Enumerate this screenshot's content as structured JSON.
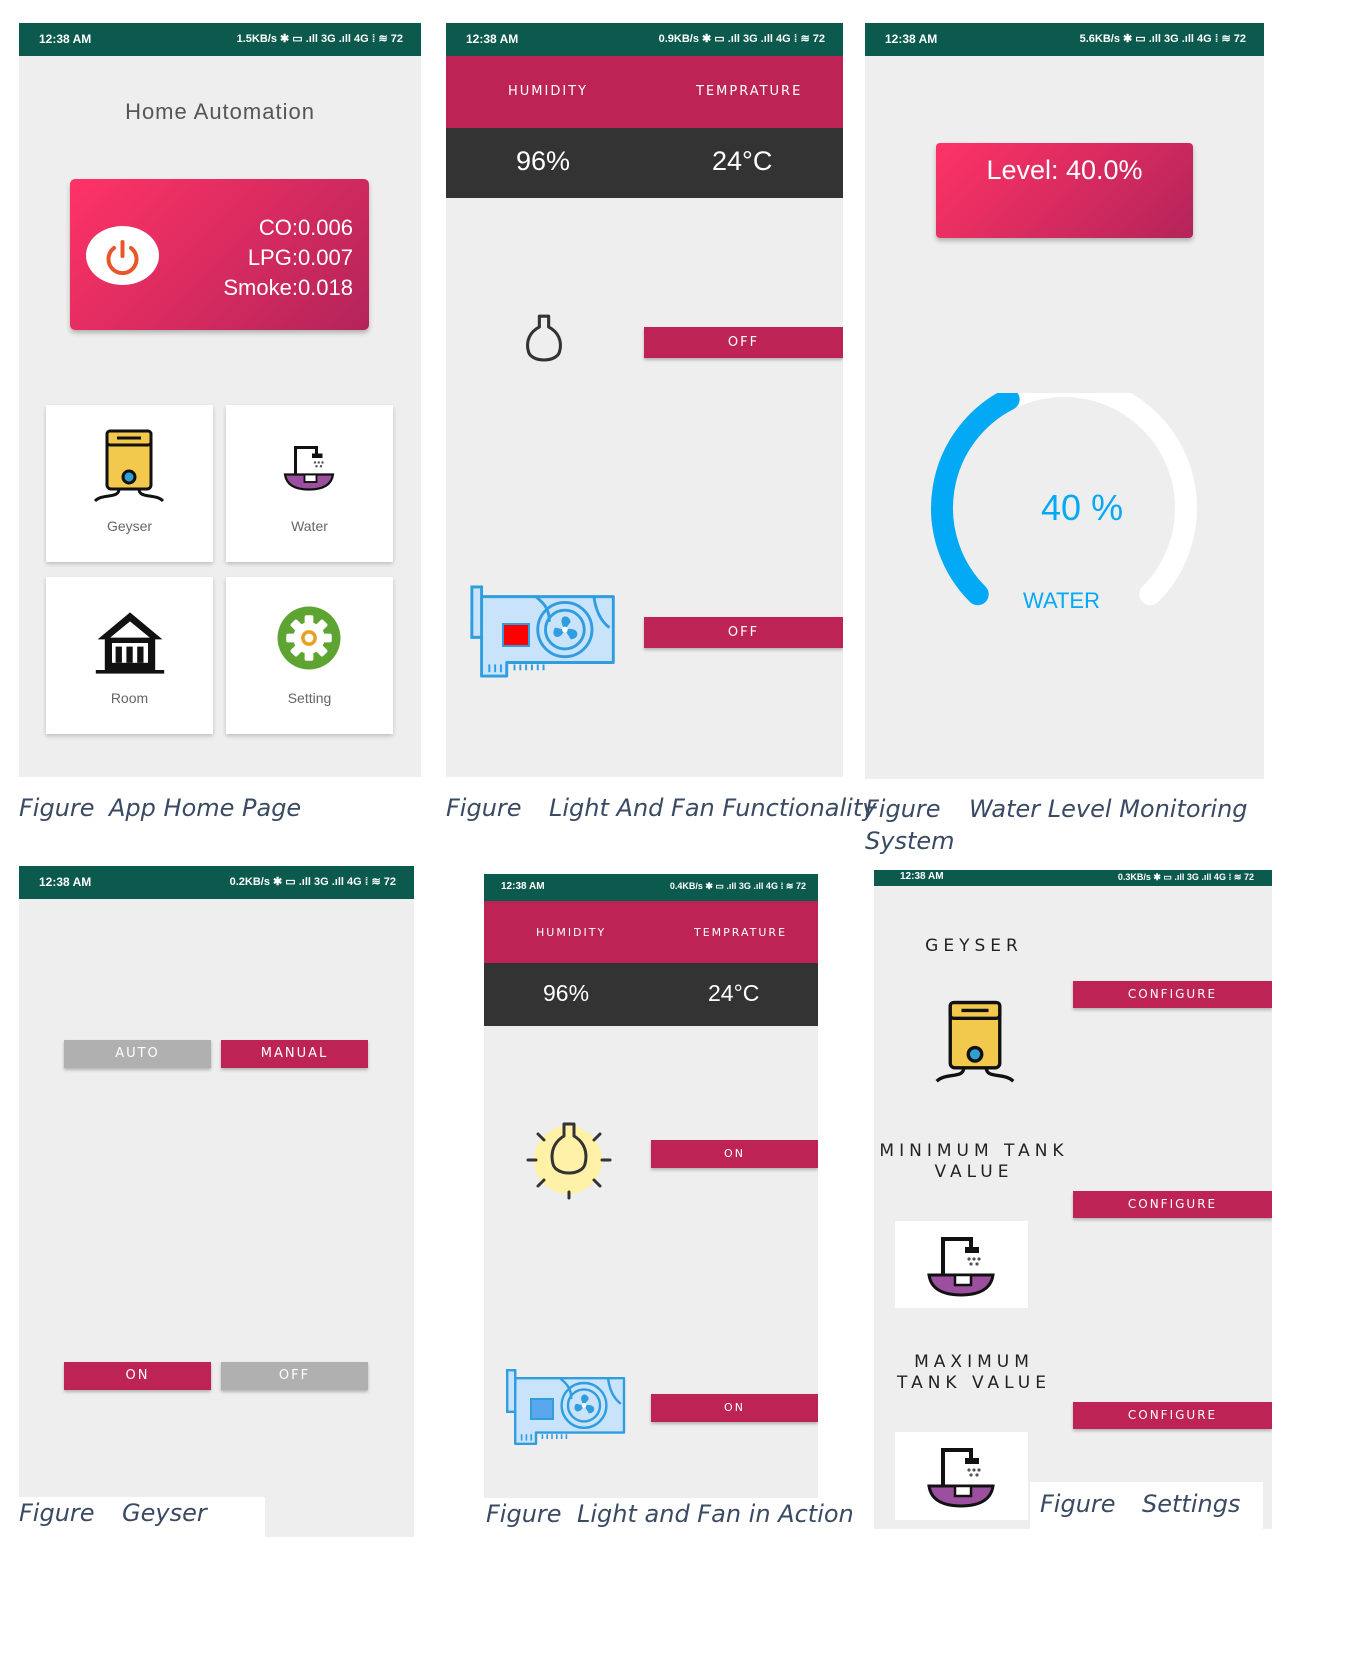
{
  "status_bar": {
    "time": "12:38 AM",
    "net_1": "1.5KB/s ✱ ▭ .ıll 3G .ıll 4G ⁞ ≋ 72",
    "net_2": "0.9KB/s ✱ ▭ .ıll 3G .ıll 4G ⁞ ≋ 72",
    "net_3": "5.6KB/s ✱ ▭ .ıll 3G .ıll 4G ⁞ ≋ 72",
    "net_4": "0.2KB/s ✱ ▭ .ıll 3G .ıll 4G ⁞ ≋ 72",
    "net_5": "0.4KB/s ✱ ▭ .ıll 3G .ıll 4G ⁞ ≋ 72",
    "net_6": "0.3KB/s ✱ ▭ .ıll 3G .ıll 4G ⁞ ≋ 72"
  },
  "home": {
    "title": "Home Automation",
    "co": "CO:0.006",
    "lpg": "LPG:0.007",
    "smoke": "Smoke:0.018",
    "tiles": [
      "Geyser",
      "Water",
      "Room",
      "Setting"
    ],
    "caption_fig": "Figure",
    "caption": "App Home Page"
  },
  "light_fan": {
    "humidity_label": "HUMIDITY",
    "temperature_label": "TEMPRATURE",
    "humidity": "96%",
    "temperature": "24°C",
    "light_state": "OFF",
    "fan_state": "OFF",
    "caption_fig": "Figure",
    "caption": "Light And Fan Functionality"
  },
  "water": {
    "level": "Level: 40.0%",
    "gauge_value": "40",
    "gauge_unit": "%",
    "gauge_label": "WATER",
    "gauge_fraction": 0.4,
    "caption_fig": "Figure",
    "caption": "Water Level Monitoring",
    "caption_line2": "System"
  },
  "geyser": {
    "auto": "AUTO",
    "manual": "MANUAL",
    "on": "ON",
    "off": "OFF",
    "caption_fig": "Figure",
    "caption": "Geyser"
  },
  "light_fan_action": {
    "humidity_label": "HUMIDITY",
    "temperature_label": "TEMPRATURE",
    "humidity": "96%",
    "temperature": "24°C",
    "light_state": "ON",
    "fan_state": "ON",
    "caption_fig": "Figure",
    "caption": "Light and Fan in Action"
  },
  "settings": {
    "geyser_label": "GEYSER",
    "min_label_1": "MINIMUM TANK",
    "min_label_2": "VALUE",
    "max_label_1": "MAXIMUM",
    "max_label_2": "TANK VALUE",
    "configure": "CONFIGURE",
    "caption_fig": "Figure",
    "caption": "Settings"
  },
  "colors": {
    "accent": "#bd2455",
    "status_bar": "#0c5a4e",
    "gauge": "#03a9f4",
    "dark_panel": "#333333"
  }
}
